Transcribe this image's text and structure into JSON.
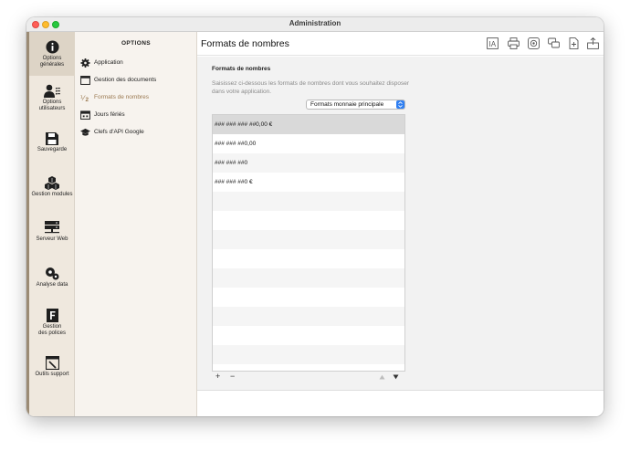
{
  "window": {
    "title": "Administration"
  },
  "leftbar": {
    "items": [
      {
        "label_1": "Options",
        "label_2": "générales",
        "icon": "info-icon"
      },
      {
        "label_1": "Options",
        "label_2": "utilisateurs",
        "icon": "users-icon"
      },
      {
        "label_1": "Sauvegarde",
        "label_2": "",
        "icon": "floppy-icon"
      },
      {
        "label_1": "Gestion modules",
        "label_2": "",
        "icon": "cubes-icon"
      },
      {
        "label_1": "Serveur Web",
        "label_2": "",
        "icon": "server-icon"
      },
      {
        "label_1": "Analyse data",
        "label_2": "",
        "icon": "gears-icon"
      },
      {
        "label_1": "Gestion",
        "label_2": "des polices",
        "icon": "font-icon"
      },
      {
        "label_1": "Outils support",
        "label_2": "",
        "icon": "tools-icon"
      }
    ]
  },
  "options": {
    "title": "OPTIONS",
    "items": [
      {
        "label": "Application",
        "icon": "gear-icon"
      },
      {
        "label": "Gestion des documents",
        "icon": "document-icon"
      },
      {
        "label": "Formats de nombres",
        "icon": "number-format-icon"
      },
      {
        "label": "Jours fériés",
        "icon": "calendar-icon"
      },
      {
        "label": "Clefs d'API Google",
        "icon": "graduation-cap-icon"
      }
    ]
  },
  "main": {
    "title": "Formats de nombres",
    "section_title": "Formats de nombres",
    "description": "Saisissez ci-dessous les formats de nombres dont vous souhaitez disposer dans votre application.",
    "select_value": "Formats monnaie principale",
    "formats": [
      "### ### ### ##0,00 €",
      "### ### ##0,00",
      "### ### ##0",
      "### ### ##0 €"
    ],
    "add_label": "+",
    "remove_label": "−"
  }
}
